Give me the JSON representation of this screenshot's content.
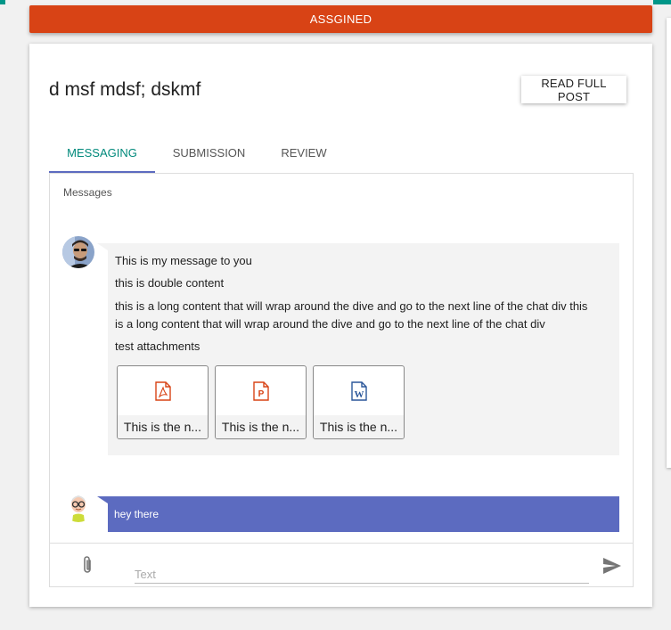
{
  "status": {
    "label": "ASSGINED"
  },
  "post": {
    "title": "d msf mdsf; dskmf",
    "read_full_label": "READ FULL POST"
  },
  "tabs": [
    {
      "label": "MESSAGING",
      "active": true
    },
    {
      "label": "SUBMISSION",
      "active": false
    },
    {
      "label": "REVIEW",
      "active": false
    }
  ],
  "messages_label": "Messages",
  "messages": [
    {
      "lines": [
        "This is my message to you",
        "this is double content",
        "this is a long content that will wrap around the dive and go to the next line of the chat div this",
        "is a long content that will wrap around the dive and go to the next line of the chat div",
        "test attachments"
      ],
      "attachments": [
        {
          "name": "This is the n...",
          "icon": "pdf-icon",
          "color": "#d84315"
        },
        {
          "name": "This is the n...",
          "icon": "powerpoint-icon",
          "color": "#d84315"
        },
        {
          "name": "This is the n...",
          "icon": "word-icon",
          "color": "#2b579a"
        }
      ]
    },
    {
      "text": "hey there"
    }
  ],
  "composer": {
    "placeholder": "Text",
    "value": ""
  },
  "colors": {
    "status": "#d84315",
    "accent": "#00897b",
    "indicator": "#5c6bc0",
    "own_bubble": "#5c6bc0",
    "teal": "#009688"
  }
}
